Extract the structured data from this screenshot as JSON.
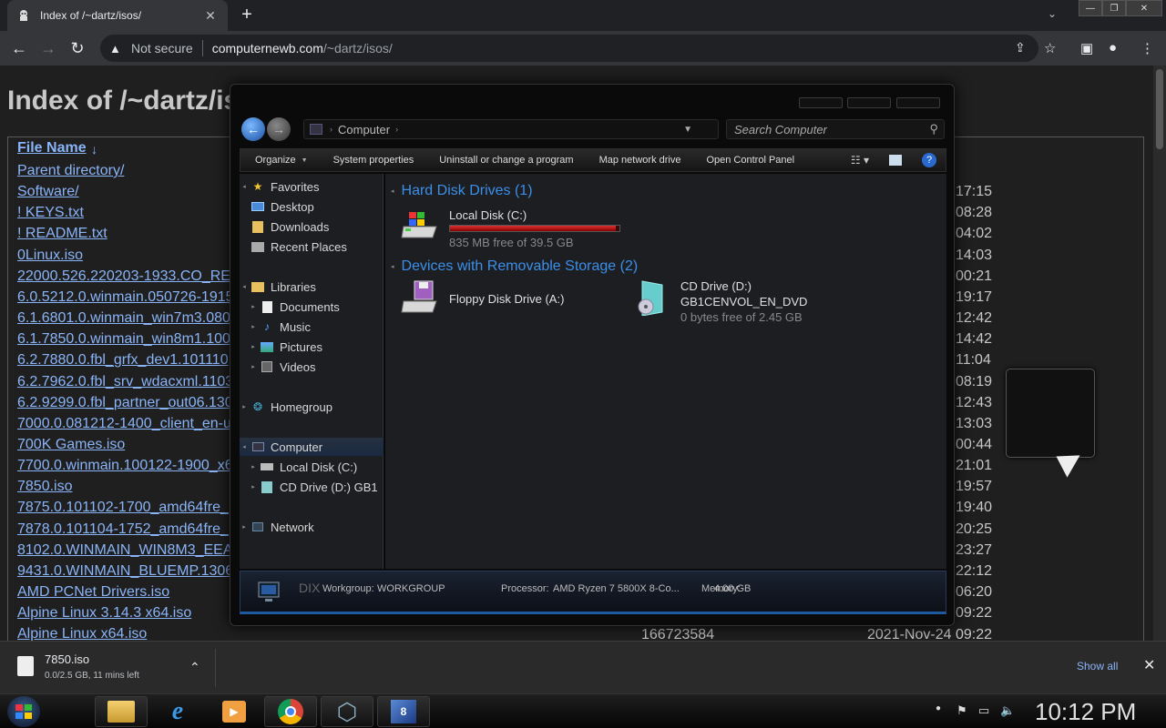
{
  "browser": {
    "tab_title": "Index of /~dartz/isos/",
    "security_label": "Not secure",
    "url_host": "computernewb.com",
    "url_path": "/~dartz/isos/"
  },
  "page": {
    "heading": "Index of /~dartz/isos/",
    "column_filename": "File Name",
    "sort_arrow": "↓",
    "files": [
      {
        "name": "Parent directory/",
        "time": ""
      },
      {
        "name": "Software/",
        "time": "17:15"
      },
      {
        "name": "! KEYS.txt",
        "time": "08:28"
      },
      {
        "name": "! README.txt",
        "time": "04:02"
      },
      {
        "name": "0Linux.iso",
        "time": "14:03"
      },
      {
        "name": "22000.526.220203-1933.CO_RE",
        "time": "00:21"
      },
      {
        "name": "6.0.5212.0.winmain.050726-1915",
        "time": "19:17"
      },
      {
        "name": "6.1.6801.0.winmain_win7m3.080",
        "time": "12:42"
      },
      {
        "name": "6.1.7850.0.winmain_win8m1.100",
        "time": "14:42"
      },
      {
        "name": "6.2.7880.0.fbl_grfx_dev1.101110",
        "time": "11:04"
      },
      {
        "name": "6.2.7962.0.fbl_srv_wdacxml.1103",
        "time": "08:19"
      },
      {
        "name": "6.2.9299.0.fbl_partner_out06.130",
        "time": "12:43"
      },
      {
        "name": "7000.0.081212-1400_client_en-u",
        "time": "13:03"
      },
      {
        "name": "700K Games.iso",
        "time": "00:44"
      },
      {
        "name": "7700.0.winmain.100122-1900_x6",
        "time": "21:01"
      },
      {
        "name": "7850.iso",
        "time": "19:57"
      },
      {
        "name": "7875.0.101102-1700_amd64fre_",
        "time": "19:40"
      },
      {
        "name": "7878.0.101104-1752_amd64fre_",
        "time": "20:25"
      },
      {
        "name": "8102.0.WINMAIN_WIN8M3_EEA",
        "time": "23:27"
      },
      {
        "name": "9431.0.WINMAIN_BLUEMP.1306",
        "time": "22:12"
      },
      {
        "name": "AMD PCNet Drivers.iso",
        "time": "06:20"
      },
      {
        "name": "Alpine Linux 3.14.3 x64.iso",
        "time": "09:22"
      },
      {
        "name": "Alpine Linux x64.iso",
        "time": ""
      }
    ],
    "last_row_size": "166723584",
    "last_row_date": "2021-Nov-24 09:22"
  },
  "explorer": {
    "address": "Computer",
    "search_placeholder": "Search Computer",
    "commands": [
      "Organize",
      "System properties",
      "Uninstall or change a program",
      "Map network drive",
      "Open Control Panel"
    ],
    "nav": {
      "favorites": "Favorites",
      "desktop": "Desktop",
      "downloads": "Downloads",
      "recent": "Recent Places",
      "libraries": "Libraries",
      "documents": "Documents",
      "music": "Music",
      "pictures": "Pictures",
      "videos": "Videos",
      "homegroup": "Homegroup",
      "computer": "Computer",
      "local_disk": "Local Disk (C:)",
      "cd_drive": "CD Drive (D:) GB1",
      "network": "Network"
    },
    "groups": {
      "hdd": "Hard Disk Drives (1)",
      "removable": "Devices with Removable Storage (2)"
    },
    "drives": {
      "c_name": "Local Disk (C:)",
      "c_free": "835 MB free of 39.5 GB",
      "c_used_fraction": 0.979,
      "floppy_name": "Floppy Disk Drive (A:)",
      "cd_name": "CD Drive (D:)",
      "cd_label": "GB1CENVOL_EN_DVD",
      "cd_free": "0 bytes free of 2.45 GB"
    },
    "details": {
      "computer_name": "DIX",
      "workgroup_label": "Workgroup:",
      "workgroup_value": "WORKGROUP",
      "processor_label": "Processor:",
      "processor_value": "AMD Ryzen 7 5800X 8-Co...",
      "memory_label": "Memory:",
      "memory_value": "4.00 GB"
    }
  },
  "download": {
    "filename": "7850.iso",
    "progress": "0.0/2.5 GB, 11 mins left",
    "show_all": "Show all"
  },
  "taskbar": {
    "clock": "10:12 PM"
  }
}
